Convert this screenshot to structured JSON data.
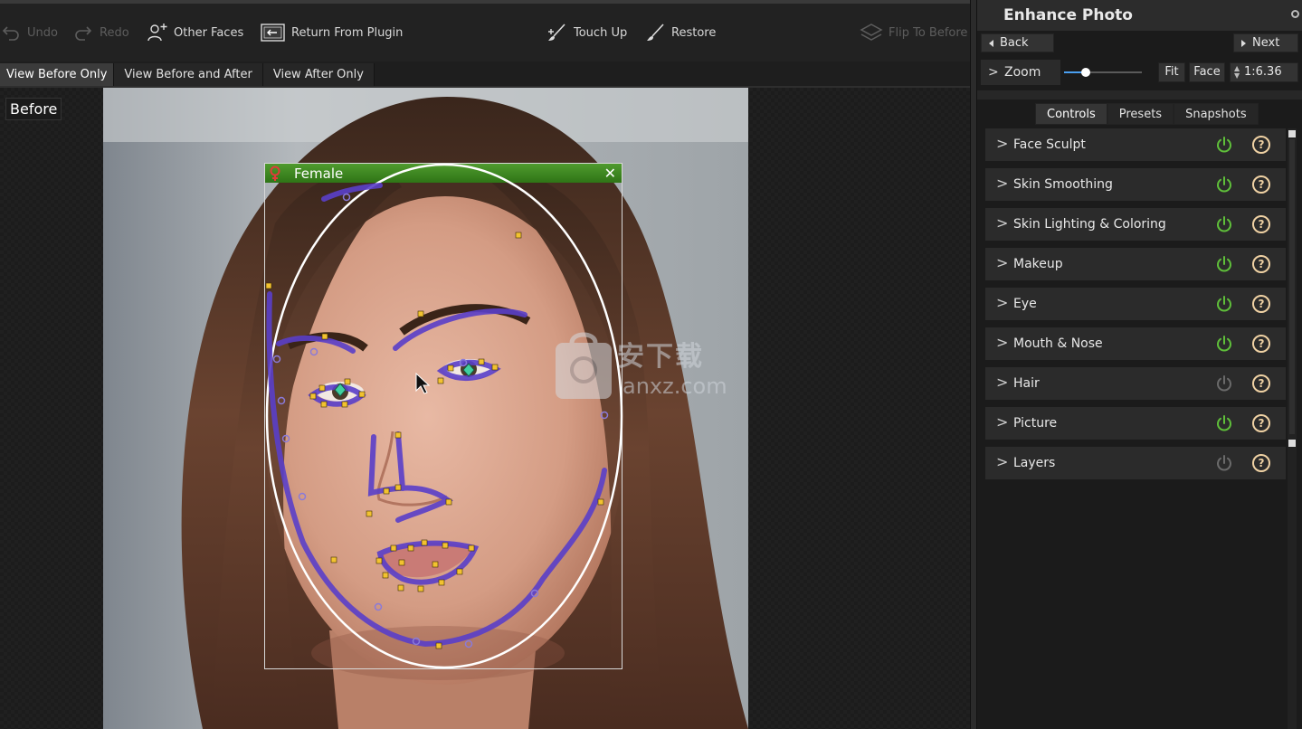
{
  "toolbar": {
    "undo_label": "Undo",
    "redo_label": "Redo",
    "other_faces_label": "Other Faces",
    "return_label": "Return From Plugin",
    "touch_up_label": "Touch Up",
    "restore_label": "Restore",
    "flip_label": "Flip To Before"
  },
  "view_tabs": [
    {
      "label": "View Before Only",
      "active": true
    },
    {
      "label": "View Before and After",
      "active": false
    },
    {
      "label": "View After Only",
      "active": false
    }
  ],
  "canvas": {
    "before_label": "Before",
    "face_box_label": "Female",
    "face_box_close": "✕",
    "watermark_cn": "安下载",
    "watermark_en": "anxz.com"
  },
  "panel": {
    "title": "Enhance Photo",
    "back_label": "Back",
    "next_label": "Next",
    "zoom_label": "Zoom",
    "zoom_chevron": ">",
    "zoom_level": 0.28,
    "fit_label": "Fit",
    "face_label": "Face",
    "zoom_ratio": "1:6.36",
    "tabs": [
      {
        "label": "Controls",
        "active": true
      },
      {
        "label": "Presets",
        "active": false
      },
      {
        "label": "Snapshots",
        "active": false
      }
    ],
    "controls": [
      {
        "name": "Face Sculpt",
        "enabled": true
      },
      {
        "name": "Skin Smoothing",
        "enabled": true
      },
      {
        "name": "Skin Lighting & Coloring",
        "enabled": true
      },
      {
        "name": "Makeup",
        "enabled": true
      },
      {
        "name": "Eye",
        "enabled": true
      },
      {
        "name": "Mouth & Nose",
        "enabled": true
      },
      {
        "name": "Hair",
        "enabled": false
      },
      {
        "name": "Picture",
        "enabled": true
      },
      {
        "name": "Layers",
        "enabled": false
      }
    ],
    "chevron": ">",
    "help_glyph": "?",
    "power_on_color": "#5fbf3a",
    "power_off_color": "#6a6a6a",
    "help_color": "#f0d2a4"
  }
}
